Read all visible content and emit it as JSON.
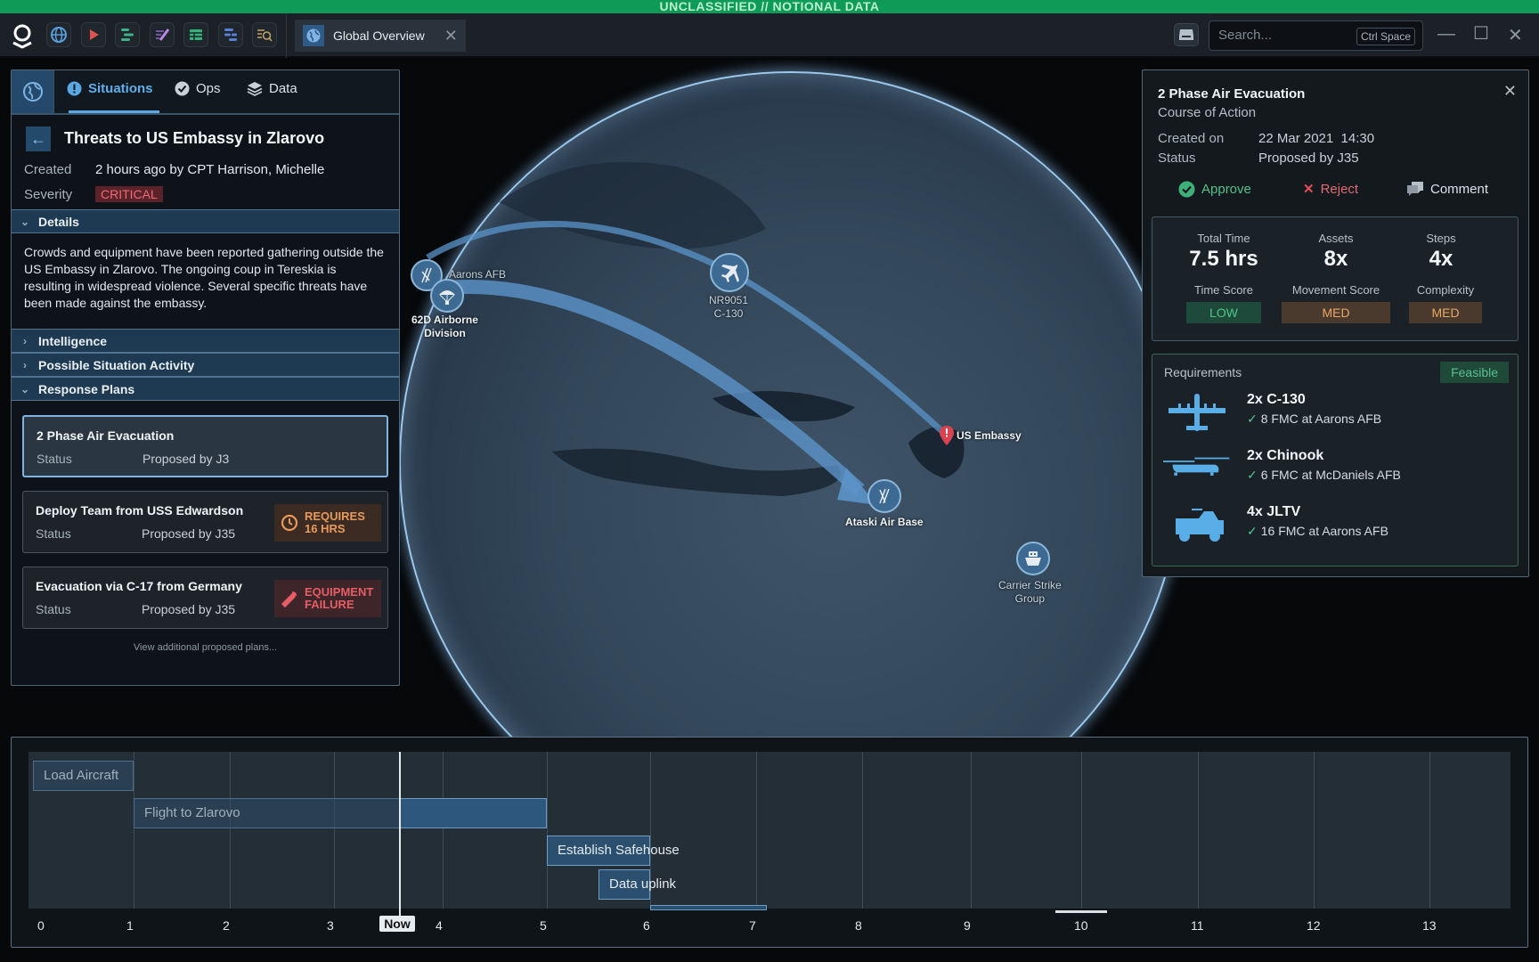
{
  "banner": "UNCLASSIFIED // NOTIONAL DATA",
  "toolbar": {
    "apps": [
      "globe-app",
      "video-app",
      "gantt-app",
      "annotate-app",
      "table-app",
      "workflow-app",
      "search-doc-app"
    ],
    "tab": {
      "label": "Global Overview",
      "icon": "globe-icon"
    },
    "search": {
      "placeholder": "Search...",
      "shortcut": "Ctrl Space"
    }
  },
  "left_panel": {
    "tabs": [
      {
        "label": "Situations",
        "icon": "alert-icon",
        "active": true
      },
      {
        "label": "Ops",
        "icon": "check-circle-icon",
        "active": false
      },
      {
        "label": "Data",
        "icon": "layers-icon",
        "active": false
      }
    ],
    "title": "Threats to US Embassy in Zlarovo",
    "created_label": "Created",
    "created_value": "2 hours ago by CPT Harrison, Michelle",
    "severity_label": "Severity",
    "severity_value": "CRITICAL",
    "sections": {
      "details": "Details",
      "intelligence": "Intelligence",
      "activity": "Possible Situation Activity",
      "response": "Response Plans"
    },
    "details_text": "Crowds and equipment have been reported gathering outside the US Embassy in Zlarovo. The ongoing coup in Tereskia is resulting in widespread violence. Several specific threats have been made against the embassy.",
    "plans": [
      {
        "title": "2 Phase Air Evacuation",
        "status_label": "Status",
        "status": "Proposed by J3",
        "selected": true
      },
      {
        "title": "Deploy Team from USS Edwardson",
        "status_label": "Status",
        "status": "Proposed by J35",
        "badge_line1": "REQUIRES",
        "badge_line2": "16 HRS",
        "badge_icon": "clock-icon"
      },
      {
        "title": "Evacuation via C-17 from Germany",
        "status_label": "Status",
        "status": "Proposed by J35",
        "badge_line1": "EQUIPMENT",
        "badge_line2": "FAILURE",
        "badge_icon": "wrench-icon"
      }
    ],
    "view_more": "View additional proposed plans..."
  },
  "map": {
    "markers": [
      {
        "label": "Aarons AFB",
        "icon": "airbase-icon"
      },
      {
        "label_line1": "62D Airborne",
        "label_line2": "Division",
        "icon": "parachute-icon"
      },
      {
        "label_line1": "NR9051",
        "label_line2": "C-130",
        "icon": "airplane-icon"
      },
      {
        "label": "US Embassy",
        "icon": "alert-pin-icon"
      },
      {
        "label": "Ataski Air Base",
        "icon": "airbase-icon"
      },
      {
        "label_line1": "Carrier Strike",
        "label_line2": "Group",
        "icon": "ship-icon"
      }
    ]
  },
  "right_panel": {
    "title": "2 Phase Air Evacuation",
    "subtitle": "Course of Action",
    "created_label": "Created on",
    "created_value": "22 Mar 2021  14:30",
    "status_label": "Status",
    "status_value": "Proposed by J35",
    "actions": {
      "approve": "Approve",
      "reject": "Reject",
      "comment": "Comment"
    },
    "stats": [
      {
        "label": "Total Time",
        "value": "7.5 hrs"
      },
      {
        "label": "Assets",
        "value": "8x"
      },
      {
        "label": "Steps",
        "value": "4x"
      }
    ],
    "scores": [
      {
        "label": "Time Score",
        "value": "LOW"
      },
      {
        "label": "Movement Score",
        "value": "MED"
      },
      {
        "label": "Complexity",
        "value": "MED"
      }
    ],
    "requirements_label": "Requirements",
    "feasible": "Feasible",
    "requirements": [
      {
        "name": "2x C-130",
        "detail": "8 FMC at Aarons AFB",
        "icon": "c130-icon"
      },
      {
        "name": "2x Chinook",
        "detail": "6 FMC at McDaniels AFB",
        "icon": "chinook-icon"
      },
      {
        "name": "4x JLTV",
        "detail": "16 FMC at Aarons AFB",
        "icon": "jltv-icon"
      }
    ]
  },
  "timeline": {
    "ticks": [
      "0",
      "1",
      "2",
      "3",
      "4",
      "5",
      "6",
      "7",
      "8",
      "9",
      "10",
      "11",
      "12",
      "13"
    ],
    "now_label": "Now",
    "now_hour": 3.6,
    "tasks": [
      {
        "label": "Load Aircraft",
        "start": 0,
        "end": 1
      },
      {
        "label": "Flight to Zlarovo",
        "start": 1,
        "end": 5
      },
      {
        "label": "Establish Safehouse",
        "start": 5,
        "end": 6
      },
      {
        "label": "Data uplink",
        "start": 5.5,
        "end": 6
      },
      {
        "label": "",
        "start": 6,
        "end": 7.1
      }
    ]
  },
  "colors": {
    "accent": "#5aa7e2",
    "classification": "#0f9a58",
    "critical": "#f06b74",
    "feasible": "#59c08d",
    "warning": "#e8a868"
  }
}
